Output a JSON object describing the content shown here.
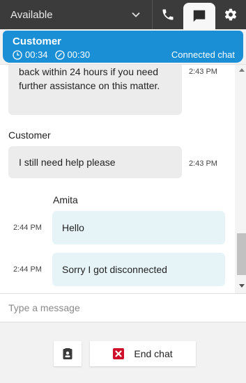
{
  "topbar": {
    "status_label": "Available",
    "icons": [
      "chevron-down-icon",
      "phone-icon",
      "chat-icon",
      "gear-icon"
    ]
  },
  "contact": {
    "name": "Customer",
    "timer_total": "00:34",
    "timer_state": "00:30",
    "state": "Connected chat",
    "color": "#1b8fd6"
  },
  "messages": [
    {
      "sender": "",
      "role": "customer",
      "text": "back within 24 hours if you need further assistance on this matter.",
      "time": "2:43 PM"
    },
    {
      "sender": "Customer",
      "role": "customer",
      "text": "I still need help please",
      "time": "2:43 PM"
    },
    {
      "sender": "Amita",
      "role": "agent",
      "text": "Hello",
      "time": "2:44 PM"
    },
    {
      "sender": "",
      "role": "agent",
      "text": "Sorry I got disconnected",
      "time": "2:44 PM"
    }
  ],
  "input": {
    "placeholder": "Type a message"
  },
  "footer": {
    "end_chat_label": "End chat"
  }
}
